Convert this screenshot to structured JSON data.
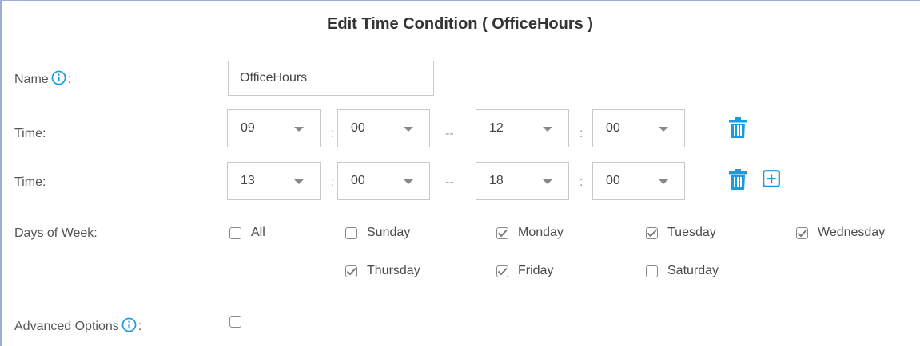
{
  "title": "Edit Time Condition ( OfficeHours )",
  "name": {
    "label": "Name",
    "colon": ":",
    "value": "OfficeHours"
  },
  "time_rows": [
    {
      "label": "Time:",
      "start_hour": "09",
      "start_min": "00",
      "end_hour": "12",
      "end_min": "00",
      "time_sep": ":",
      "range_sep": "--"
    },
    {
      "label": "Time:",
      "start_hour": "13",
      "start_min": "00",
      "end_hour": "18",
      "end_min": "00",
      "time_sep": ":",
      "range_sep": "--"
    }
  ],
  "days_of_week": {
    "label": "Days of Week:",
    "all": {
      "label": "All",
      "checked": false
    },
    "days": [
      {
        "label": "Sunday",
        "checked": false
      },
      {
        "label": "Monday",
        "checked": true
      },
      {
        "label": "Tuesday",
        "checked": true
      },
      {
        "label": "Wednesday",
        "checked": true
      },
      {
        "label": "Thursday",
        "checked": true
      },
      {
        "label": "Friday",
        "checked": true
      },
      {
        "label": "Saturday",
        "checked": false
      }
    ]
  },
  "advanced_options": {
    "label": "Advanced Options",
    "colon": ":",
    "checked": false
  },
  "colors": {
    "accent": "#1a9be0",
    "border": "#c9c9c9",
    "frame": "#9aaed2"
  },
  "icons": {
    "info": "info-icon",
    "delete": "trash-icon",
    "add": "plus-square-icon",
    "dropdown": "chevron-down-icon",
    "checked": "check-icon"
  }
}
